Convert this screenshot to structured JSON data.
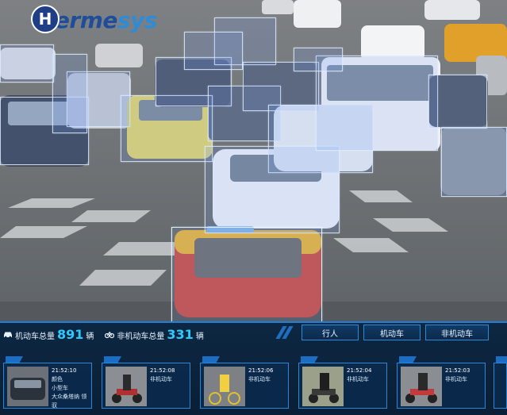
{
  "brand": {
    "logo_letter": "H",
    "name_part1": "Herme",
    "name_part2": "sys"
  },
  "stats": {
    "motor": {
      "icon": "car-icon",
      "label": "机动车总量",
      "value": "891",
      "unit": "辆"
    },
    "nonmotor": {
      "icon": "bicycle-icon",
      "label": "非机动车总量",
      "value": "331",
      "unit": "辆"
    }
  },
  "tabs": [
    {
      "label": "行人"
    },
    {
      "label": "机动车"
    },
    {
      "label": "非机动车"
    }
  ],
  "cards": [
    {
      "time": "21:52:10",
      "lines": [
        "颜色",
        "小型车",
        "大众桑塔纳 领驭"
      ],
      "thumb": "car"
    },
    {
      "time": "21:52:08",
      "lines": [
        "非机动车"
      ],
      "thumb": "scooter"
    },
    {
      "time": "21:52:06",
      "lines": [
        "非机动车"
      ],
      "thumb": "bike"
    },
    {
      "time": "21:52:04",
      "lines": [
        "非机动车"
      ],
      "thumb": "scooter"
    },
    {
      "time": "21:52:03",
      "lines": [
        "非机动车"
      ],
      "thumb": "scooter"
    }
  ],
  "colors": {
    "accent": "#2ec9ff",
    "panel_border": "#1f7fd6",
    "detection_box": "#dcebff"
  }
}
